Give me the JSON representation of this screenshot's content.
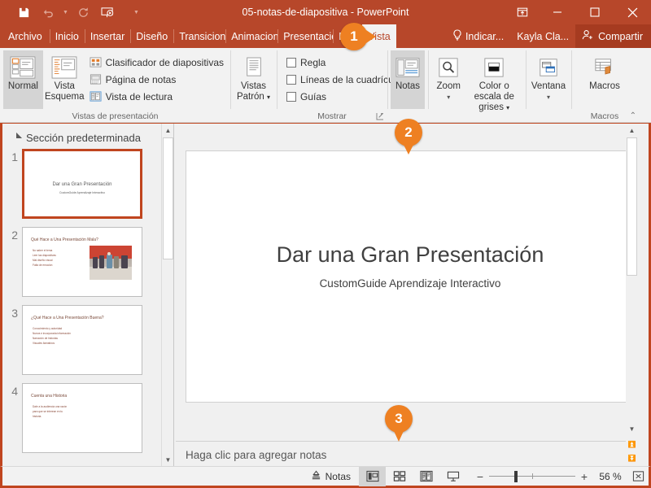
{
  "titlebar": {
    "document_title": "05-notas-de-diapositiva  -  PowerPoint",
    "qat": [
      {
        "name": "save-icon",
        "label": "Guardar"
      },
      {
        "name": "undo-icon",
        "label": "Deshacer"
      },
      {
        "name": "redo-icon",
        "label": "Rehacer"
      },
      {
        "name": "start-slideshow-icon",
        "label": "Iniciar presentación"
      },
      {
        "name": "customize-qat-icon",
        "label": "Personalizar barra de herramientas"
      }
    ],
    "window_controls": [
      {
        "name": "ribbon-display-options-icon",
        "label": "Opciones de presentación de la cinta"
      },
      {
        "name": "minimize-icon",
        "label": "Minimizar"
      },
      {
        "name": "maximize-icon",
        "label": "Maximizar"
      },
      {
        "name": "close-icon",
        "label": "Cerrar"
      }
    ]
  },
  "tabs": {
    "items": [
      {
        "label": "Archivo",
        "active": false
      },
      {
        "label": "Inicio",
        "active": false
      },
      {
        "label": "Insertar",
        "active": false
      },
      {
        "label": "Diseño",
        "active": false
      },
      {
        "label": "Transiciones",
        "active": false
      },
      {
        "label": "Animaciones",
        "active": false
      },
      {
        "label": "Presentación",
        "active": false
      },
      {
        "label": "Revisar",
        "active": false
      },
      {
        "label": "Vista",
        "active": true
      }
    ],
    "tell_me": "Indicar...",
    "user_name": "Kayla Cla...",
    "share_label": "Compartir"
  },
  "ribbon": {
    "groups": [
      {
        "label": "Vistas de presentación",
        "big_buttons": [
          {
            "label": "Normal",
            "selected": true,
            "icon": "normal-view-icon"
          },
          {
            "label": "Vista Esquema",
            "selected": false,
            "icon": "outline-view-icon"
          }
        ],
        "small_buttons": [
          {
            "label": "Clasificador de diapositivas",
            "icon": "slide-sorter-icon"
          },
          {
            "label": "Página de notas",
            "icon": "notes-page-icon"
          },
          {
            "label": "Vista de lectura",
            "icon": "reading-view-icon"
          }
        ]
      },
      {
        "label": "",
        "big_buttons": [
          {
            "label": "Vistas Patrón",
            "selected": false,
            "icon": "master-views-icon",
            "has_dropdown": true
          }
        ],
        "small_buttons": []
      },
      {
        "label": "Mostrar",
        "big_buttons": [],
        "checkboxes": [
          {
            "label": "Regla",
            "checked": false
          },
          {
            "label": "Líneas de la cuadrícula",
            "checked": false
          },
          {
            "label": "Guías",
            "checked": false
          }
        ],
        "dialog_launcher": true
      },
      {
        "label": "",
        "big_buttons": [
          {
            "label": "Notas",
            "selected": true,
            "icon": "notes-icon"
          }
        ],
        "small_buttons": []
      },
      {
        "label": "",
        "big_buttons": [
          {
            "label": "Zoom",
            "selected": false,
            "icon": "zoom-icon",
            "has_dropdown": true
          },
          {
            "label": "Color o escala de grises",
            "selected": false,
            "icon": "color-grayscale-icon",
            "has_dropdown": true
          }
        ],
        "small_buttons": []
      },
      {
        "label": "",
        "big_buttons": [
          {
            "label": "Ventana",
            "selected": false,
            "icon": "window-icon",
            "has_dropdown": true
          }
        ],
        "small_buttons": []
      },
      {
        "label": "Macros",
        "big_buttons": [
          {
            "label": "Macros",
            "selected": false,
            "icon": "macros-icon"
          }
        ],
        "small_buttons": [],
        "collapse": true
      }
    ]
  },
  "thumbnail_pane": {
    "section_name": "Sección predeterminada",
    "slides": [
      {
        "number": "1",
        "current": true,
        "title": "Dar una Gran Presentación",
        "subtitle": "CustomGuide Aprendizaje Interactivo",
        "bullets": [],
        "has_image": false
      },
      {
        "number": "2",
        "current": false,
        "title": "Qué Hace a Una Presentación Mala?",
        "subtitle": "",
        "bullets": [
          "No saber el tema",
          "Leer las diapositivas",
          "Mal diseño visual",
          "Falta de emoción"
        ],
        "has_image": true
      },
      {
        "number": "3",
        "current": false,
        "title": "¿Qué Hace a Una Presentación Buena?",
        "subtitle": "",
        "bullets": [
          "Conocimiento y autoridad",
          "Nueva e incorporada información",
          "Narración de historias",
          "Visuales llamativos"
        ],
        "has_image": false
      },
      {
        "number": "4",
        "current": false,
        "title": "Cuenta una Historia",
        "subtitle": "",
        "bullets": [
          "Dale a la audiencia una razón",
          "para que se interese en tu",
          "historia."
        ],
        "has_image": false
      }
    ]
  },
  "slide": {
    "title": "Dar una Gran Presentación",
    "subtitle": "CustomGuide Aprendizaje Interactivo",
    "notes_placeholder": "Haga clic para agregar notas"
  },
  "statusbar": {
    "notes_label": "Notas",
    "views": [
      {
        "name": "normal-view-button",
        "label": "Normal",
        "active": true
      },
      {
        "name": "slide-sorter-button",
        "label": "Clasificador de diapositivas",
        "active": false
      },
      {
        "name": "reading-view-button",
        "label": "Vista de lectura",
        "active": false
      },
      {
        "name": "slideshow-button",
        "label": "Presentación con diapositivas",
        "active": false
      }
    ],
    "zoom_out_label": "−",
    "zoom_in_label": "+",
    "zoom_percent": "56 %",
    "fit_label": "Ajustar diapositiva a la ventana actual"
  },
  "callouts": [
    {
      "number": "1"
    },
    {
      "number": "2"
    },
    {
      "number": "3"
    }
  ],
  "colors": {
    "brand": "#b7472a",
    "window_border": "#c0451f",
    "callout": "#ee8022",
    "ribbon_bg": "#f2f2f2"
  }
}
